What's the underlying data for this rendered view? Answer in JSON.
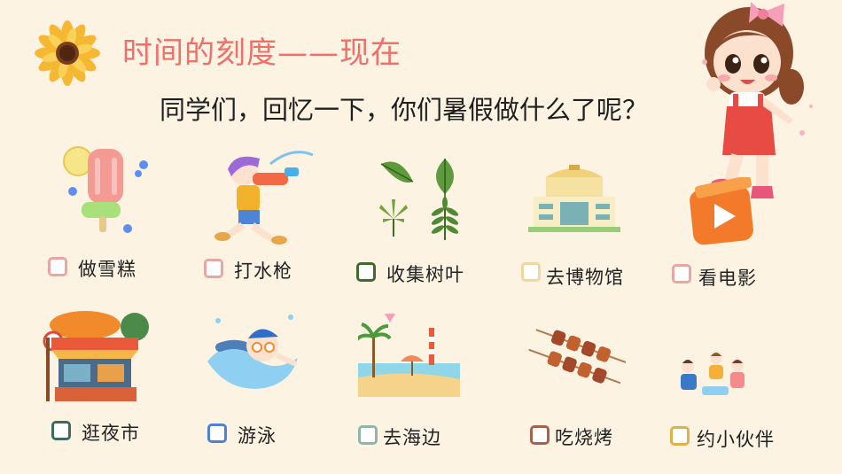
{
  "header": {
    "title": "时间的刻度——现在",
    "question": "同学们，回忆一下，你们暑假做什么了呢？"
  },
  "colors": {
    "background": "#fcf3e3",
    "title": "#ef6f6a"
  },
  "activities": [
    {
      "label": "做雪糕",
      "checkbox_color": "#e9a6a2",
      "icon": "popsicle-icon"
    },
    {
      "label": "打水枪",
      "checkbox_color": "#e9a6a2",
      "icon": "water-gun-child-icon"
    },
    {
      "label": "收集树叶",
      "checkbox_color": "#3e6b2c",
      "icon": "leaves-icon"
    },
    {
      "label": "去博物馆",
      "checkbox_color": "#efd7a0",
      "icon": "museum-building-icon"
    },
    {
      "label": "看电影",
      "checkbox_color": "#e9a6a2",
      "icon": "movie-play-icon"
    },
    {
      "label": "逛夜市",
      "checkbox_color": "#3e6b5c",
      "icon": "night-market-stall-icon"
    },
    {
      "label": "游泳",
      "checkbox_color": "#4f7fd8",
      "icon": "swimmer-icon"
    },
    {
      "label": "去海边",
      "checkbox_color": "#8fb6a8",
      "icon": "beach-icon"
    },
    {
      "label": "吃烧烤",
      "checkbox_color": "#a9604a",
      "icon": "bbq-skewers-icon"
    },
    {
      "label": "约小伙伴",
      "checkbox_color": "#e0b04a",
      "icon": "friends-playing-icon"
    }
  ]
}
